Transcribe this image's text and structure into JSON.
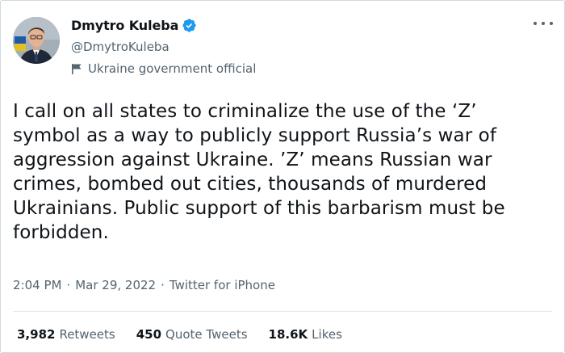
{
  "author": {
    "name": "Dmytro Kuleba",
    "handle": "@DmytroKuleba",
    "label": "Ukraine government official"
  },
  "tweet": {
    "text": "I call on all states to criminalize the use of the ‘Z’\nsymbol as a way to publicly support Russia’s war of\naggression against Ukraine. ’Z’ means Russian war\ncrimes, bombed out cities, thousands of murdered\nUkrainians. Public support of this barbarism must be\nforbidden."
  },
  "meta": {
    "time": "2:04 PM",
    "date": "Mar 29, 2022",
    "source": "Twitter for iPhone",
    "separator": "·"
  },
  "stats": [
    {
      "count": "3,982",
      "label": "Retweets"
    },
    {
      "count": "450",
      "label": "Quote Tweets"
    },
    {
      "count": "18.6K",
      "label": "Likes"
    }
  ],
  "icons": {
    "verified": "verified-badge-icon",
    "gov": "flag-icon",
    "more": "more-dots-icon"
  },
  "colors": {
    "verified_blue": "#1d9bf0",
    "text": "#0f1419",
    "secondary": "#536471"
  }
}
